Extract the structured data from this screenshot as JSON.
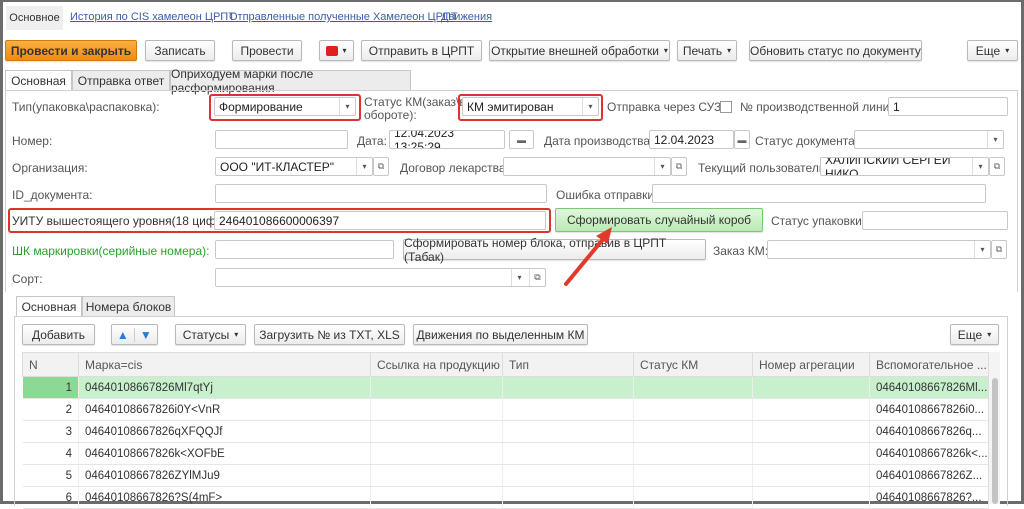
{
  "nav": {
    "tabs": [
      "Основное",
      "История по CIS хамелеон ЦРПТ",
      "Отправленные полученные Хамелеон ЦРПТ",
      "Движения"
    ]
  },
  "toolbar": {
    "post_close": "Провести и закрыть",
    "save": "Записать",
    "post": "Провести",
    "send_crpt": "Отправить в ЦРПТ",
    "open_ext": "Открытие внешней обработки",
    "print": "Печать",
    "update_status": "Обновить статус по документу",
    "more": "Еще"
  },
  "form_tabs": [
    "Основная",
    "Отправка ответ",
    "Оприходуем марки после расформирования"
  ],
  "form": {
    "type_label": "Тип(упаковка\\распаковка):",
    "type_value": "Формирование",
    "km_status_label1": "Статус КМ(заказ\\в",
    "km_status_label2": "обороте):",
    "km_status_value": "КМ эмитирован",
    "suz_label": "Отправка через СУЗ:",
    "suz_checked": false,
    "line_label": "№ производственной линии:",
    "line_value": "1",
    "number_label": "Номер:",
    "number_value": "",
    "date_label": "Дата:",
    "date_value": "12.04.2023 13:25:29",
    "prod_date_label": "Дата производства:",
    "prod_date_value": "12.04.2023",
    "doc_status_label": "Статус документа:",
    "doc_status_value": "",
    "org_label": "Организация:",
    "org_value": "ООО \"ИТ-КЛАСТЕР\"",
    "contract_label": "Договор лекарства:",
    "contract_value": "",
    "user_label": "Текущий пользователь:",
    "user_value": "ХАЛИПСКИЙ СЕРГЕЙ НИКО",
    "docid_label": "ID_документа:",
    "docid_value": "",
    "send_error_label": "Ошибка отправки:",
    "send_error_value": "",
    "sscc_label": "УИТУ вышестоящего уровня(18 цифр):",
    "sscc_value": "246401086600006397",
    "random_box_button": "Сформировать случайный короб",
    "pack_status_label": "Статус упаковки:",
    "pack_status_value": "",
    "barcode_label": "ШК маркировки(серийные номера):",
    "barcode_value": "",
    "block_button": "Сформировать номер блока, отправив в ЦРПТ (Табак)",
    "km_order_label": "Заказ КМ:",
    "km_order_value": "",
    "sort_label": "Сорт:",
    "sort_value": ""
  },
  "inner_tabs": [
    "Основная",
    "Номера блоков"
  ],
  "table_toolbar": {
    "add": "Добавить",
    "statuses": "Статусы",
    "load": "Загрузить № из TXT, XLS",
    "movements": "Движения по выделенным КМ",
    "more": "Еще"
  },
  "table": {
    "columns": [
      "N",
      "Марка=cis",
      "Ссылка на продукцию",
      "Тип",
      "Статус КМ",
      "Номер агрегации",
      "Вспомогательное ..."
    ],
    "rows": [
      [
        "1",
        "04640108667826Ml7qtYj",
        "",
        "",
        "",
        "",
        "04640108667826Ml..."
      ],
      [
        "2",
        "04640108667826i0Y<VnR",
        "",
        "",
        "",
        "",
        "04640108667826i0..."
      ],
      [
        "3",
        "04640108667826qXFQQJf",
        "",
        "",
        "",
        "",
        "04640108667826q..."
      ],
      [
        "4",
        "04640108667826k<XOFbE",
        "",
        "",
        "",
        "",
        "04640108667826k<..."
      ],
      [
        "5",
        "04640108667826ZYlMJu9",
        "",
        "",
        "",
        "",
        "04640108667826Z..."
      ],
      [
        "6",
        "04640108667826?S(4mF>",
        "",
        "",
        "",
        "",
        "04640108667826?..."
      ]
    ]
  },
  "colors": {
    "primary": "#f0961a",
    "highlight": "#e03131",
    "selected_row": "#c8f0cc",
    "green_label": "#2aa02a"
  }
}
